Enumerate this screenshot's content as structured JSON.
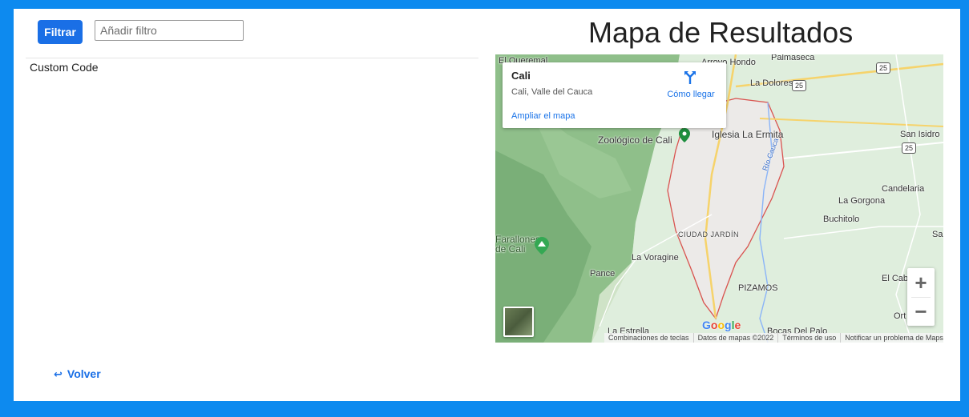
{
  "filter": {
    "button_label": "Filtrar",
    "input_placeholder": "Añadir filtro",
    "input_value": ""
  },
  "content": {
    "custom_code": "Custom Code"
  },
  "map_section": {
    "title": "Mapa de Resultados",
    "info_card": {
      "title": "Cali",
      "subtitle": "Cali, Valle del Cauca",
      "directions_label": "Cómo llegar",
      "enlarge_label": "Ampliar el mapa"
    },
    "places": {
      "el_queremal": "El Queremal",
      "arroyo_hondo": "Arroyo Hondo",
      "palmaseca": "Palmaseca",
      "la_dolores": "La Dolores",
      "zoologico": "Zoológico de Cali",
      "iglesia": "Iglesia La Ermita",
      "rio_cauca": "Río Cauca",
      "san_isidro": "San Isidro",
      "candelaria": "Candelaria",
      "la_gorgona": "La Gorgona",
      "buchitolo": "Buchitolo",
      "sa": "Sa",
      "ciudad_jardin": "CIUDAD JARDÍN",
      "farallones": "Farallones de Cali",
      "la_voragine": "La Voragine",
      "pance": "Pance",
      "el_cab": "El Cab",
      "pizamos": "PIZAMOS",
      "ort": "Ort",
      "la_estrella": "La Estrella",
      "bocas_del_palo": "Bocas Del Palo"
    },
    "route_shields": {
      "r25a": "25",
      "r25b": "25",
      "r25c": "25"
    },
    "google_logo": "Google",
    "attribution": {
      "shortcuts": "Combinaciones de teclas",
      "map_data": "Datos de mapas ©2022",
      "terms": "Términos de uso",
      "report": "Notificar un problema de Maps"
    },
    "zoom": {
      "in_label": "+",
      "out_label": "−"
    }
  },
  "footer": {
    "back_label": "Volver",
    "back_icon": "↩"
  },
  "colors": {
    "background": "#0d8aef",
    "primary": "#1a6fe6",
    "map_link": "#1a73e8",
    "city_boundary": "#d9534f"
  }
}
